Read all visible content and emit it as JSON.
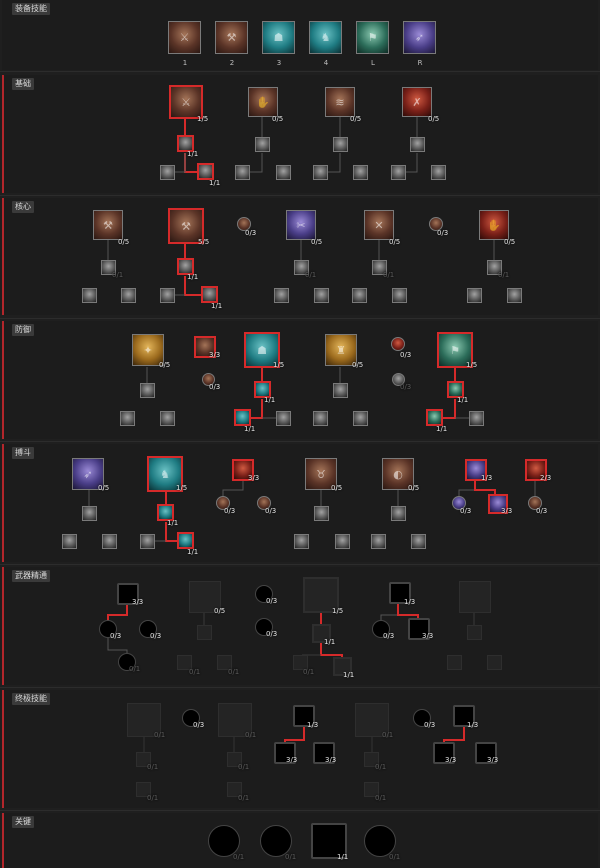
{
  "sections": {
    "equip": "装备技能",
    "basic": "基础",
    "core": "核心",
    "defense": "防御",
    "brawl": "搏斗",
    "weapon": "武器精通",
    "ultimate": "终极技能",
    "key": "关键"
  },
  "slots": [
    "1",
    "2",
    "3",
    "4",
    "L",
    "R"
  ],
  "levels": {
    "b1": "1/5",
    "b2": "0/5",
    "b3": "0/5",
    "b4": "0/5",
    "b1a": "1/1",
    "b1b": "1/1",
    "c1": "0/5",
    "c2": "5/5",
    "c3": "0/3",
    "c4": "0/5",
    "c5": "0/5",
    "c6": "0/3",
    "c7": "0/5",
    "c1a": "0/1",
    "c2a": "1/1",
    "c2b": "1/1",
    "c4a": "0/1",
    "c5a": "0/1",
    "c7a": "0/1",
    "d1": "0/5",
    "d2": "3/3",
    "d3": "0/3",
    "d4": "1/5",
    "d5": "0/5",
    "d6": "0/3",
    "d7": "0/3",
    "d8": "1/5",
    "d4a": "1/1",
    "d4b": "1/1",
    "d8a": "1/1",
    "d8b": "1/1",
    "r1": "0/5",
    "r2": "1/5",
    "r3": "3/3",
    "r4": "0/3",
    "r5": "0/3",
    "r6": "0/5",
    "r7": "0/5",
    "r8": "1/3",
    "r9": "2/3",
    "r10": "0/3",
    "r11": "3/3",
    "r12": "0/3",
    "r2a": "1/1",
    "r2b": "1/1",
    "w1": "3/3",
    "w2": "0/3",
    "w3": "0/3",
    "w4": "0/1",
    "w5": "0/5",
    "w6": "0/3",
    "w7": "0/3",
    "w8": "1/5",
    "w8a": "1/1",
    "w8b": "1/1",
    "w9": "1/3",
    "w10": "0/3",
    "w11": "3/3",
    "w5a": "0/1",
    "w5b": "0/1",
    "w12": "0/1",
    "u1": "0/1",
    "u2": "0/3",
    "u3": "0/1",
    "u4": "1/3",
    "u5": "3/3",
    "u6": "3/3",
    "u7": "0/1",
    "u8": "0/3",
    "u9": "1/3",
    "u10": "3/3",
    "u11": "3/3",
    "u1a": "0/1",
    "u1b": "0/1",
    "u3a": "0/1",
    "u3b": "0/1",
    "u7a": "0/1",
    "u7b": "0/1",
    "k1": "0/1",
    "k2": "0/1",
    "k3": "1/1",
    "k4": "0/1"
  },
  "colors": {
    "selected": "#d52a2a",
    "rail": "#b3262b",
    "background": "#1f1f1f"
  }
}
